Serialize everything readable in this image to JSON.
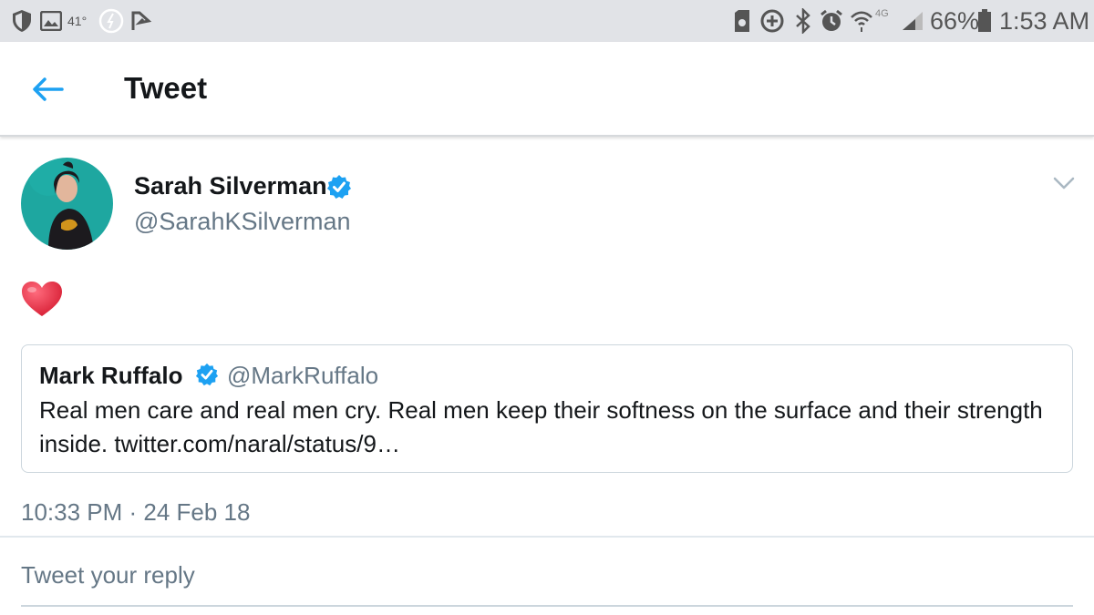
{
  "status_bar": {
    "temperature": "41°",
    "battery_percent": "66%",
    "time": "1:53 AM",
    "network": "4G",
    "icons_left": [
      "shield-icon",
      "image-icon",
      "temperature-text",
      "pause-circle-icon",
      "check-flag-icon"
    ],
    "icons_right": [
      "sd-card-icon",
      "data-saver-icon",
      "bluetooth-icon",
      "alarm-icon",
      "wifi-icon",
      "network-4g-icon",
      "signal-icon",
      "battery-icon"
    ]
  },
  "app_bar": {
    "title": "Tweet",
    "back_icon": "arrow-left-icon"
  },
  "tweet": {
    "author_name": "Sarah Silverman",
    "author_handle": "@SarahKSilverman",
    "verified": true,
    "content_emoji": "red-heart-emoji",
    "timestamp": "10:33 PM · 24 Feb 18",
    "quoted": {
      "author_name": "Mark Ruffalo",
      "author_handle": "@MarkRuffalo",
      "verified": true,
      "text": "Real men care and real men cry. Real men keep their softness on the surface and their strength inside. twitter.com/naral/status/9…"
    }
  },
  "reply": {
    "placeholder": "Tweet your reply"
  },
  "colors": {
    "accent": "#1da1f2",
    "text_primary": "#14171a",
    "text_secondary": "#657786",
    "status_bar_bg": "#e1e3e7",
    "heart": "#e0245e"
  }
}
